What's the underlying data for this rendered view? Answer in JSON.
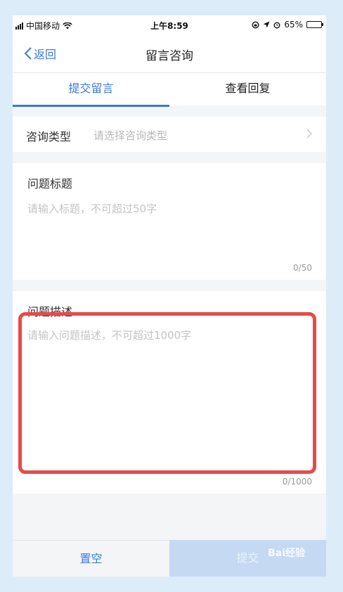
{
  "status_bar": {
    "carrier": "中国移动",
    "time": "上午8:59",
    "battery": "65%",
    "battery_level": 0.65
  },
  "nav": {
    "back_label": "返回",
    "title": "留言咨询"
  },
  "tabs": [
    {
      "label": "提交留言",
      "active": true
    },
    {
      "label": "查看回复",
      "active": false
    }
  ],
  "form": {
    "type_label": "咨询类型",
    "type_placeholder": "请选择咨询类型",
    "title_label": "问题标题",
    "title_placeholder": "请输入标题，不可超过50字",
    "title_counter": "0/50",
    "desc_label": "问题描述",
    "desc_placeholder": "请输入问题描述，不可超过1000字",
    "desc_counter": "0/1000"
  },
  "footer": {
    "clear_label": "置空",
    "submit_label": "提交"
  },
  "watermark": "Bai经验",
  "colors": {
    "accent": "#3a7bd5",
    "highlight": "#e84a4a",
    "submit_disabled": "#c5d9f3"
  }
}
